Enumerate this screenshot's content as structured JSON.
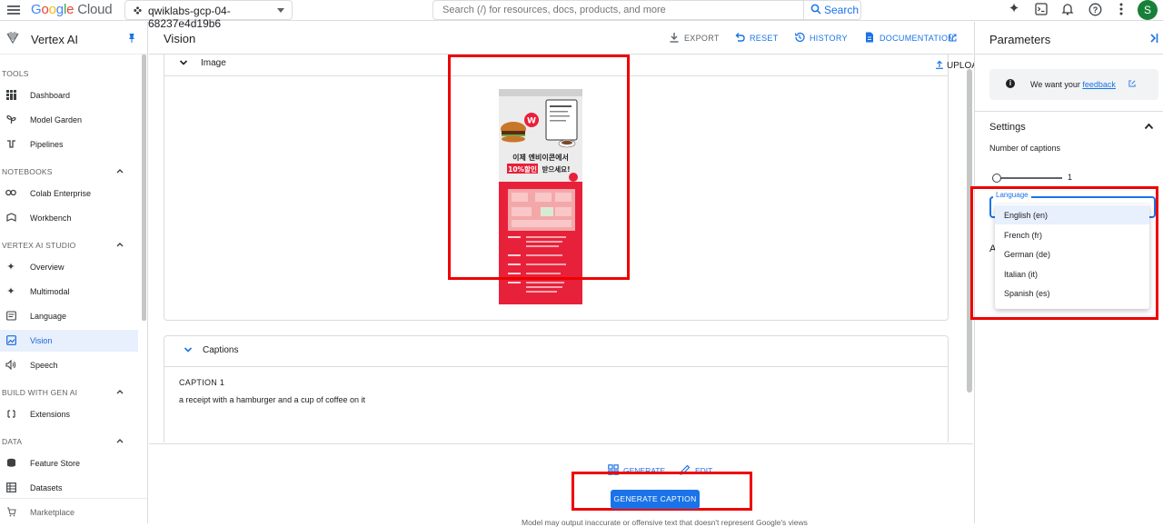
{
  "topbar": {
    "logo_parts": [
      "G",
      "o",
      "o",
      "g",
      "l",
      "e"
    ],
    "logo_suffix": "Cloud",
    "project": "qwiklabs-gcp-04-68237e4d19b6",
    "search_placeholder": "Search (/) for resources, docs, products, and more",
    "search_button": "Search",
    "avatar_letter": "S",
    "icons": [
      "gemini-icon",
      "cloud-shell-icon",
      "notifications-icon",
      "help-icon",
      "more-vert-icon"
    ]
  },
  "leftnav": {
    "title": "Vertex AI",
    "sections": {
      "tools": "TOOLS",
      "notebooks": "NOTEBOOKS",
      "studio": "VERTEX AI STUDIO",
      "build": "BUILD WITH GEN AI",
      "data": "DATA"
    },
    "items": {
      "dashboard": "Dashboard",
      "model_garden": "Model Garden",
      "pipelines": "Pipelines",
      "colab": "Colab Enterprise",
      "workbench": "Workbench",
      "overview": "Overview",
      "multimodal": "Multimodal",
      "language": "Language",
      "vision": "Vision",
      "speech": "Speech",
      "extensions": "Extensions",
      "feature_store": "Feature Store",
      "datasets": "Datasets",
      "marketplace": "Marketplace"
    },
    "active_item": "Vision"
  },
  "main": {
    "title": "Vision",
    "actions": {
      "export": "EXPORT",
      "reset": "RESET",
      "history": "HISTORY",
      "documentation": "DOCUMENTATION"
    },
    "image_card": {
      "title": "Image",
      "upload": "UPLOAD IMAGE",
      "poster_headline_1": "이제 엔비이콘에서",
      "poster_headline_2a": "10%할인",
      "poster_headline_2b": "받으세요!"
    },
    "captions_card": {
      "title": "Captions",
      "caption_label": "CAPTION 1",
      "caption_text": "a receipt with a hamburger and a cup of coffee on it"
    },
    "bottom": {
      "tab_generate": "GENERATE",
      "tab_edit": "EDIT",
      "generate_button": "GENERATE CAPTION",
      "disclaimer": "Model may output inaccurate or offensive text that doesn't represent Google's views"
    }
  },
  "params": {
    "title": "Parameters",
    "feedback_prefix": "We want your",
    "feedback_link": "feedback",
    "settings": "Settings",
    "num_captions_label": "Number of captions",
    "num_captions_value": "1",
    "num_captions_fraction": 0.0,
    "language_label": "Language",
    "advanced_initial": "A",
    "language_options": [
      "English (en)",
      "French (fr)",
      "German (de)",
      "Italian (it)",
      "Spanish (es)"
    ],
    "selected_language": "English (en)"
  },
  "colors": {
    "accent": "#1a73e8",
    "highlight_frame": "#e00000",
    "active_nav_bg": "#e8f0fe",
    "poster_red": "#e8213a"
  }
}
